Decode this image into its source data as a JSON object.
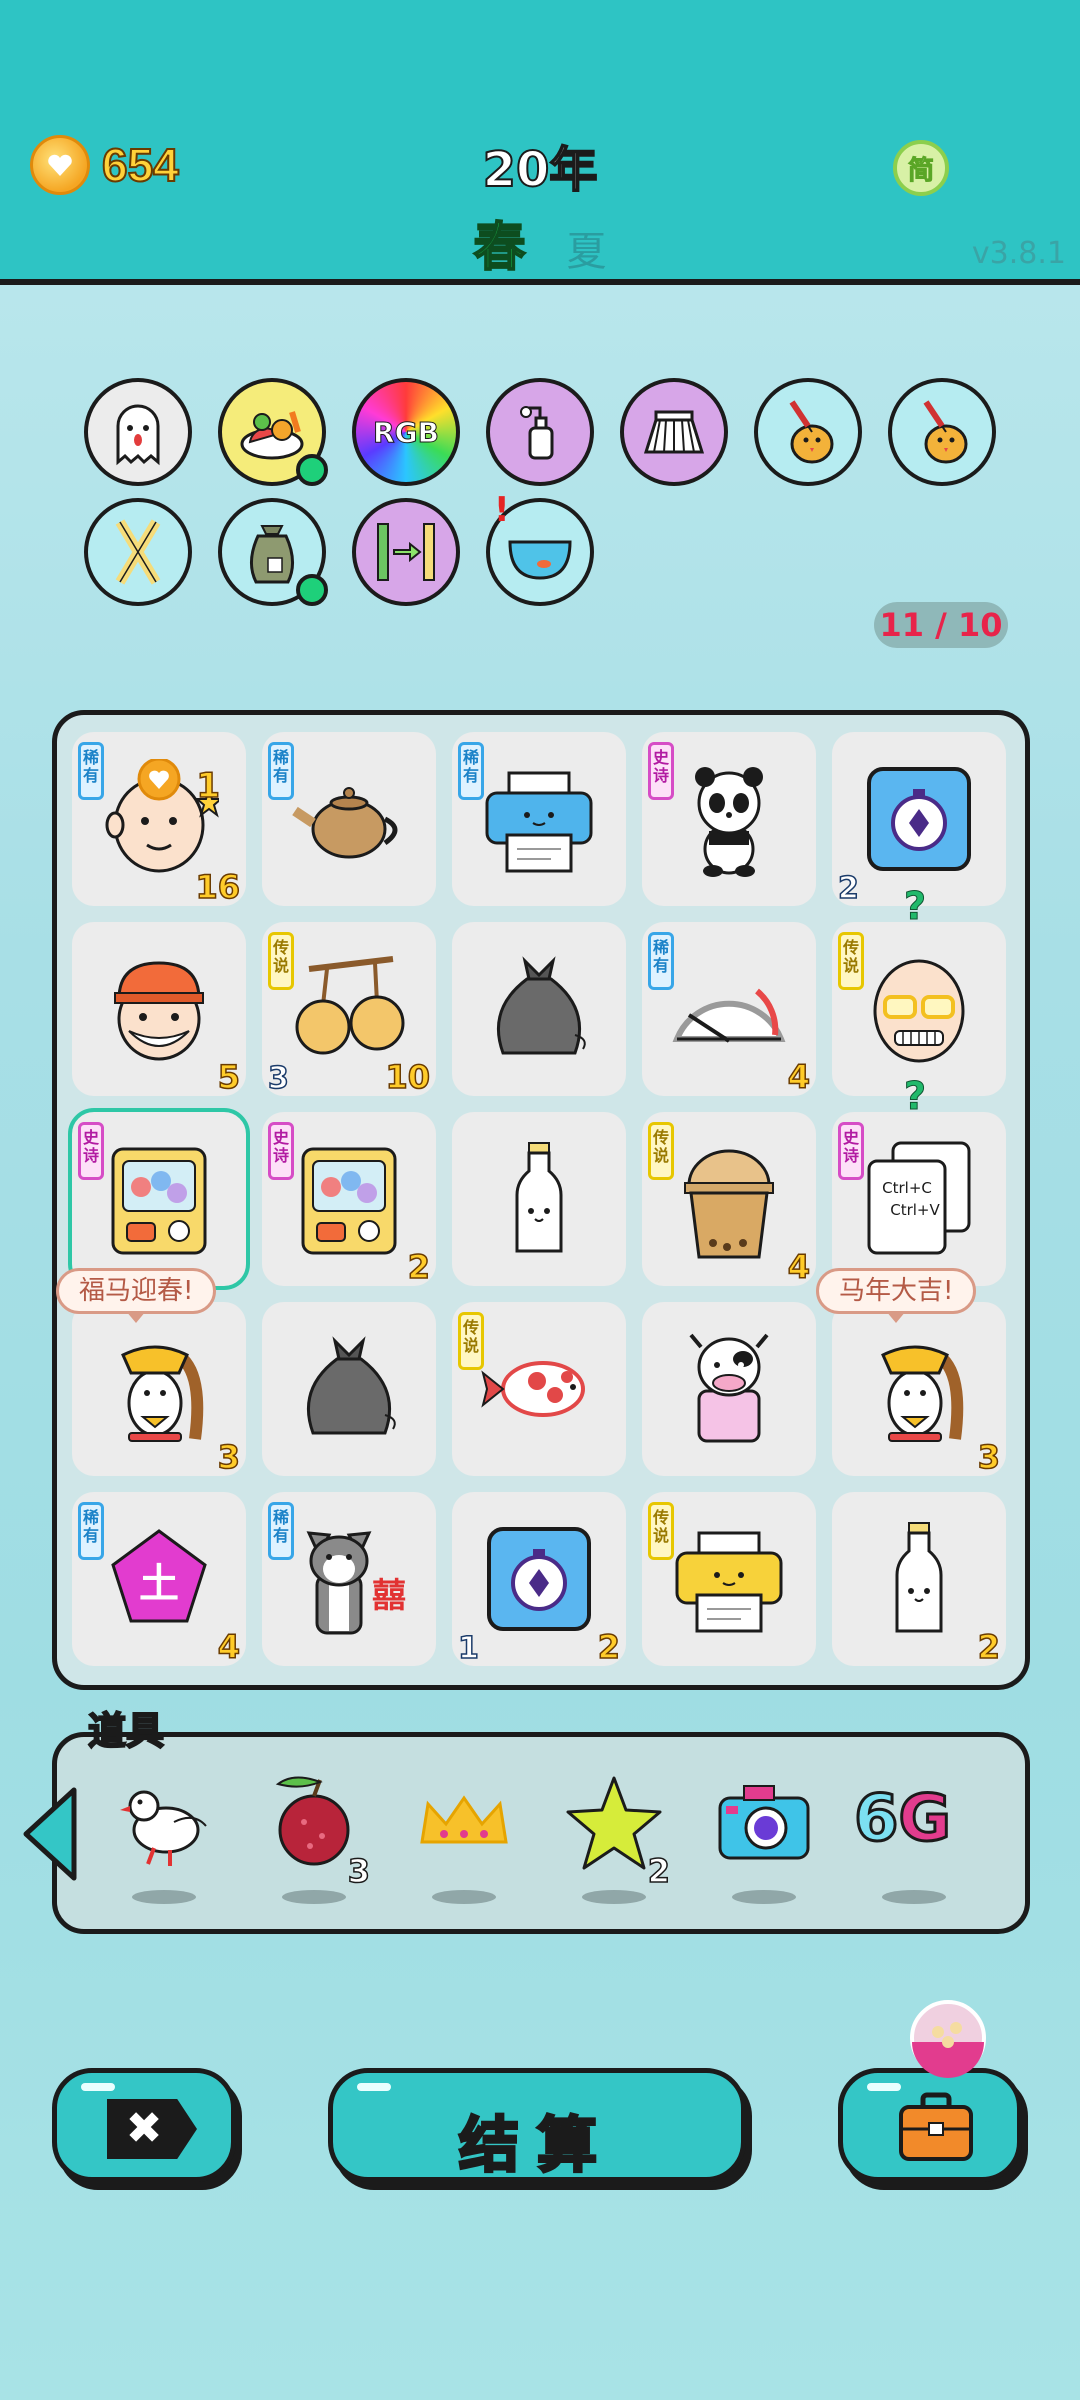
{
  "header": {
    "coins": "654",
    "year": "20年",
    "season_active": "春",
    "season_next": "夏",
    "lang_label": "简",
    "version": "v3.8.1"
  },
  "collection": {
    "icons": [
      "ghost-icon",
      "fruit-plate-icon",
      "rgb-orb-icon",
      "pump-bottle-icon",
      "pleated-skirt-icon",
      "chick-syringe-icon",
      "chick-syringe-icon",
      "crossed-sticks-icon",
      "seed-bag-icon",
      "bamboo-swap-icon",
      "fishbowl-icon"
    ],
    "alert": "!",
    "progress": "11 / 10"
  },
  "badges": {
    "rare": "稀有",
    "epic": "史诗",
    "legend": "传说"
  },
  "board": {
    "rows": [
      [
        {
          "item": "grandpa-face-icon",
          "badge": "稀有",
          "br": "16",
          "tr": "1"
        },
        {
          "item": "teapot-icon",
          "badge": "稀有"
        },
        {
          "item": "blue-printer-icon",
          "badge": "稀有"
        },
        {
          "item": "panda-icon",
          "badge": "史诗"
        },
        {
          "item": "stopwatch-card-icon",
          "bl": "2"
        }
      ],
      [
        {
          "item": "capped-man-face-icon",
          "br": "5"
        },
        {
          "item": "cherry-icon",
          "badge": "传说",
          "bl": "3",
          "br": "10"
        },
        {
          "item": "garbage-bag-icon"
        },
        {
          "item": "gauge-icon",
          "badge": "稀有",
          "br": "4"
        },
        {
          "item": "bald-grandpa-glasses-icon",
          "badge": "传说",
          "q": "?"
        }
      ],
      [
        {
          "item": "gacha-machine-icon",
          "badge": "史诗",
          "selected": true
        },
        {
          "item": "gacha-machine-icon",
          "badge": "史诗",
          "br": "2"
        },
        {
          "item": "milk-bottle-icon"
        },
        {
          "item": "bubble-tea-icon",
          "badge": "传说",
          "br": "4"
        },
        {
          "item": "ctrl-cv-cards-icon",
          "badge": "史诗",
          "q": "?",
          "text1": "Ctrl+C",
          "text2": "Ctrl+V"
        }
      ],
      [
        {
          "item": "horse-gold-ingot-icon",
          "br": "3",
          "bubble": "福马迎春!"
        },
        {
          "item": "garbage-bag-icon"
        },
        {
          "item": "koi-fish-icon",
          "badge": "传说"
        },
        {
          "item": "cow-icon"
        },
        {
          "item": "horse-gold-ingot-icon",
          "br": "3",
          "bubble": "马年大吉!"
        }
      ],
      [
        {
          "item": "pentagon-earth-icon",
          "badge": "稀有",
          "br": "4",
          "glyph": "土"
        },
        {
          "item": "husky-icon",
          "badge": "稀有",
          "glyph": "囍"
        },
        {
          "item": "stopwatch-card-icon",
          "bl": "1",
          "br": "2"
        },
        {
          "item": "yellow-printer-icon",
          "badge": "传说"
        },
        {
          "item": "milk-bottle-icon",
          "br": "2"
        }
      ]
    ]
  },
  "props": {
    "title": "道具",
    "items": [
      {
        "icon": "dove-icon",
        "count": ""
      },
      {
        "icon": "lychee-icon",
        "count": "3"
      },
      {
        "icon": "crown-icon",
        "count": ""
      },
      {
        "icon": "star-icon",
        "count": "2"
      },
      {
        "icon": "camera-icon",
        "count": ""
      },
      {
        "icon": "6g-icon",
        "count": "",
        "text_a": "6",
        "text_b": "G"
      }
    ]
  },
  "buttons": {
    "cancel_symbol": "✖",
    "settle_label": "结算"
  },
  "colors": {
    "header_bg": "#2ec4c4",
    "coin_text": "#ffd23a",
    "spring": "#18b34a",
    "progress_text": "#e8244a",
    "button_bg": "#34c6c6"
  }
}
